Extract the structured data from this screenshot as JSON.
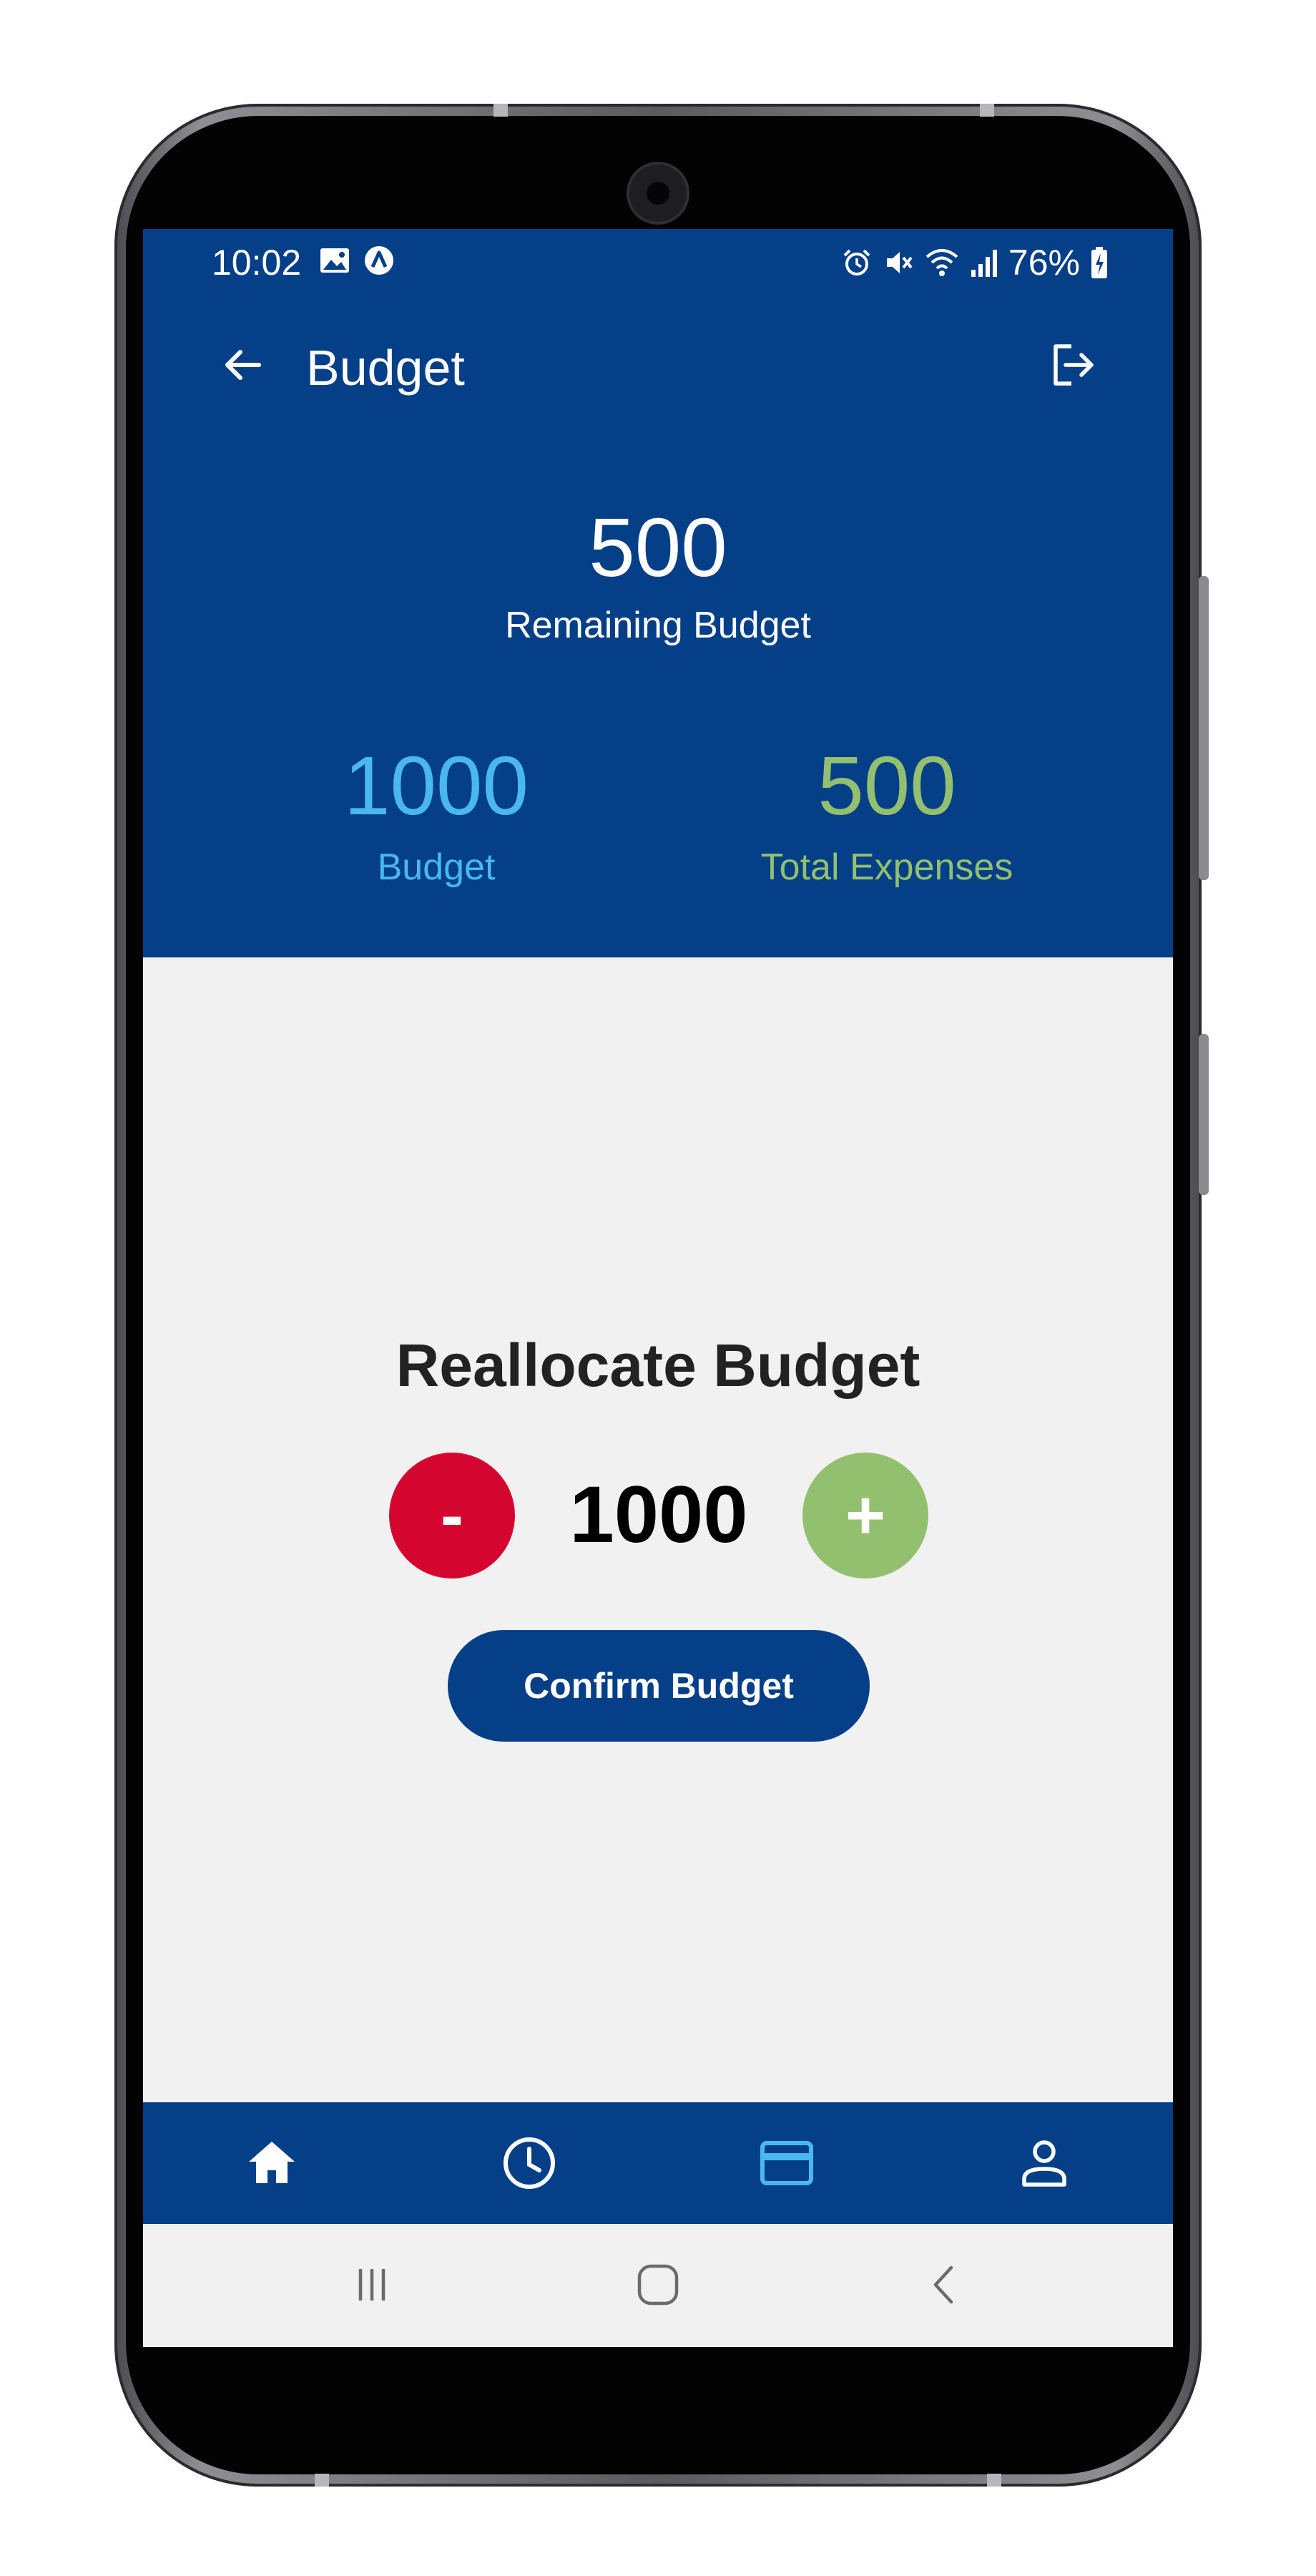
{
  "status_bar": {
    "time": "10:02",
    "battery": "76%",
    "left_icons": [
      "image-icon",
      "app-notification-icon"
    ],
    "right_icons": [
      "alarm-icon",
      "mute-icon",
      "wifi-icon",
      "signal-icon",
      "battery-charging-icon"
    ]
  },
  "app_bar": {
    "title": "Budget",
    "back_icon": "arrow-left-icon",
    "logout_icon": "logout-icon"
  },
  "summary": {
    "remaining_value": "500",
    "remaining_label": "Remaining Budget",
    "budget_value": "1000",
    "budget_label": "Budget",
    "expenses_value": "500",
    "expenses_label": "Total Expenses"
  },
  "reallocate": {
    "title": "Reallocate Budget",
    "minus_label": "-",
    "value": "1000",
    "plus_label": "+",
    "confirm_label": "Confirm Budget"
  },
  "bottom_nav": {
    "items": [
      {
        "icon": "home-icon",
        "active": false
      },
      {
        "icon": "history-clock-icon",
        "active": false
      },
      {
        "icon": "credit-card-icon",
        "active": true
      },
      {
        "icon": "profile-icon",
        "active": false
      }
    ]
  },
  "system_nav": [
    "recents-icon",
    "home-circle-icon",
    "back-chevron-icon"
  ],
  "colors": {
    "primary": "#043f88",
    "budget": "#4ab7ee",
    "expenses": "#92c06e",
    "minus": "#d4052f",
    "plus": "#92c06e",
    "active_nav": "#4ab7ee",
    "background": "#f1f1f1"
  }
}
